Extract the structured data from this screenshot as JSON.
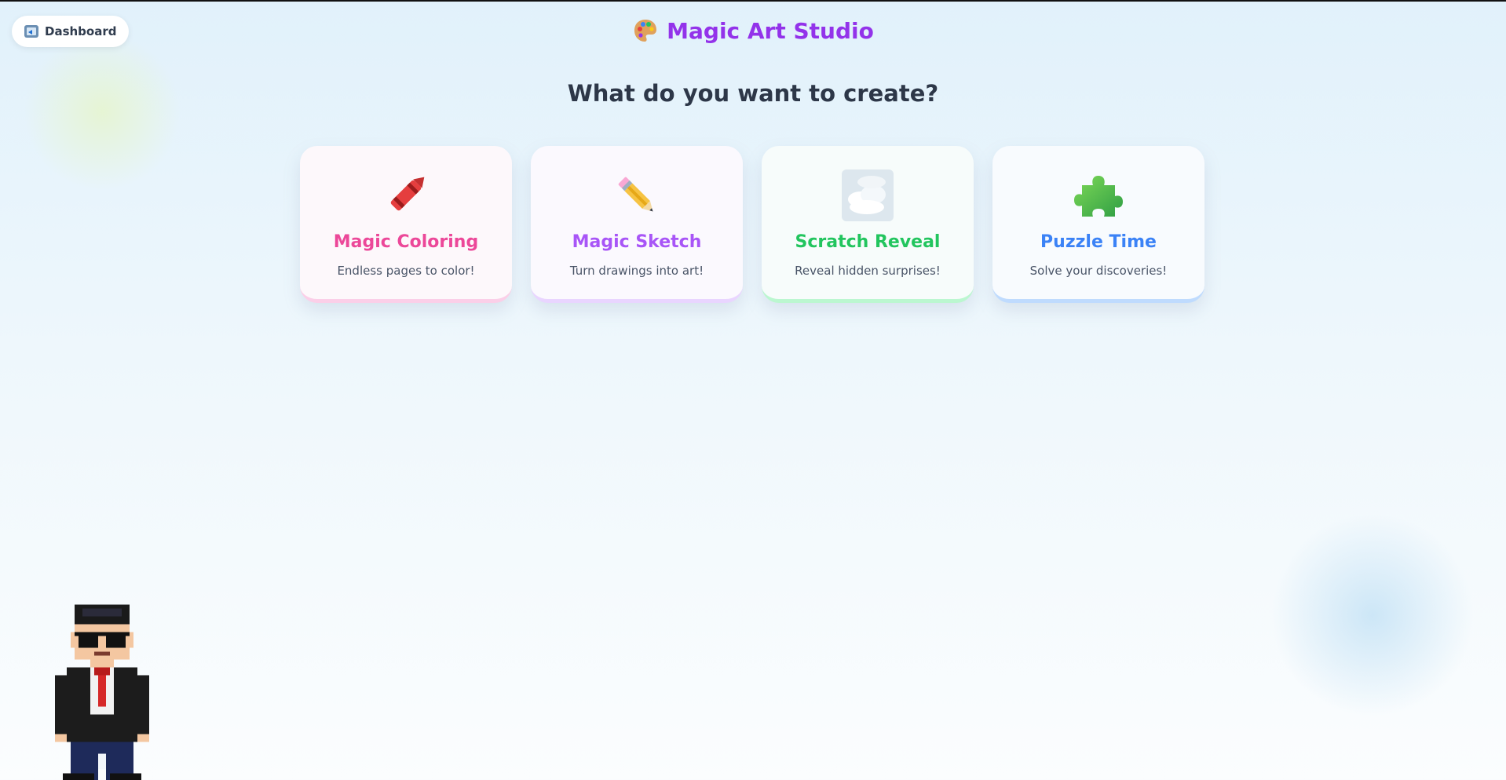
{
  "nav": {
    "dashboard_label": "Dashboard",
    "dashboard_icon": "back-to-dashboard-icon"
  },
  "app": {
    "title": "Magic Art Studio",
    "title_icon": "palette-icon",
    "title_color": "#9333ea"
  },
  "main": {
    "heading": "What do you want to create?"
  },
  "cards": [
    {
      "title": "Magic Coloring",
      "description": "Endless pages to color!",
      "icon": "crayon-icon",
      "color": "#ec4899"
    },
    {
      "title": "Magic Sketch",
      "description": "Turn drawings into art!",
      "icon": "pencil-icon",
      "color": "#a855f7"
    },
    {
      "title": "Scratch Reveal",
      "description": "Reveal hidden surprises!",
      "icon": "cloud-icon",
      "color": "#22c55e"
    },
    {
      "title": "Puzzle Time",
      "description": "Solve your discoveries!",
      "icon": "puzzle-piece-icon",
      "color": "#3b82f6"
    }
  ],
  "character": {
    "icon": "pixel-businessman-icon"
  }
}
